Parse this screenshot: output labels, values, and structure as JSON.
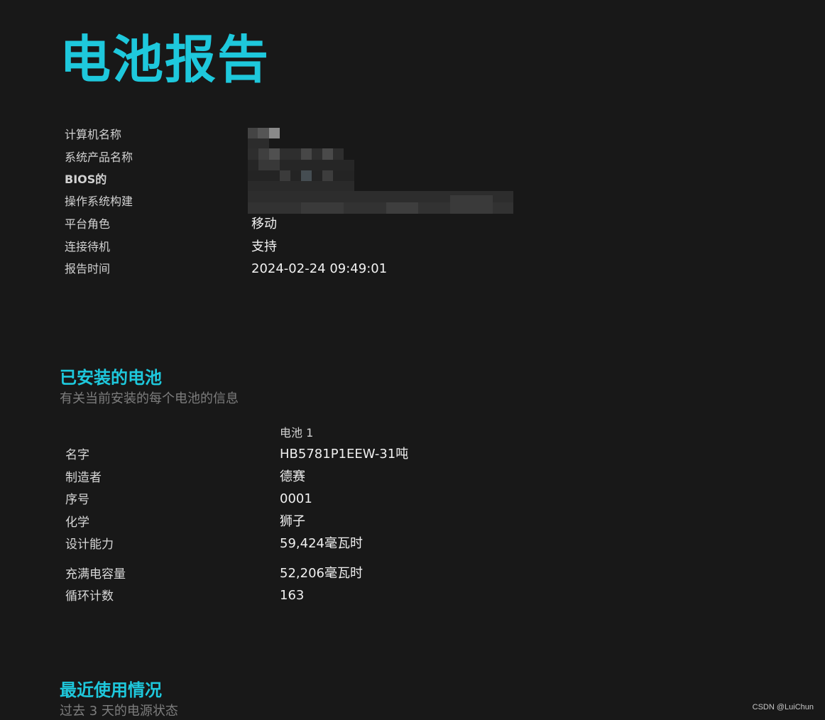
{
  "page": {
    "title": "电池报告"
  },
  "system_info": {
    "rows": [
      {
        "label": "计算机名称",
        "value": ""
      },
      {
        "label": "系统产品名称",
        "value": ""
      },
      {
        "label": "BIOS的",
        "value": ""
      },
      {
        "label": "操作系统构建",
        "value": ""
      },
      {
        "label": "平台角色",
        "value": "移动"
      },
      {
        "label": "连接待机",
        "value": "支持"
      },
      {
        "label": "报告时间",
        "value": "2024-02-24  09:49:01"
      }
    ]
  },
  "installed_batteries": {
    "title": "已安装的电池",
    "subtitle": "有关当前安装的每个电池的信息",
    "column_header": "电池 1",
    "rows": [
      {
        "label": "名字",
        "value": "HB5781P1EEW-31吨"
      },
      {
        "label": "制造者",
        "value": "德赛"
      },
      {
        "label": "序号",
        "value": "0001"
      },
      {
        "label": "化学",
        "value": "狮子"
      },
      {
        "label": "设计能力",
        "value": "59,424毫瓦时"
      },
      {
        "label": "充满电容量",
        "value": "52,206毫瓦时"
      },
      {
        "label": "循环计数",
        "value": "163"
      }
    ]
  },
  "recent_usage": {
    "title": "最近使用情况",
    "subtitle": "过去 3 天的电源状态"
  },
  "watermark": "CSDN @LuiChun"
}
